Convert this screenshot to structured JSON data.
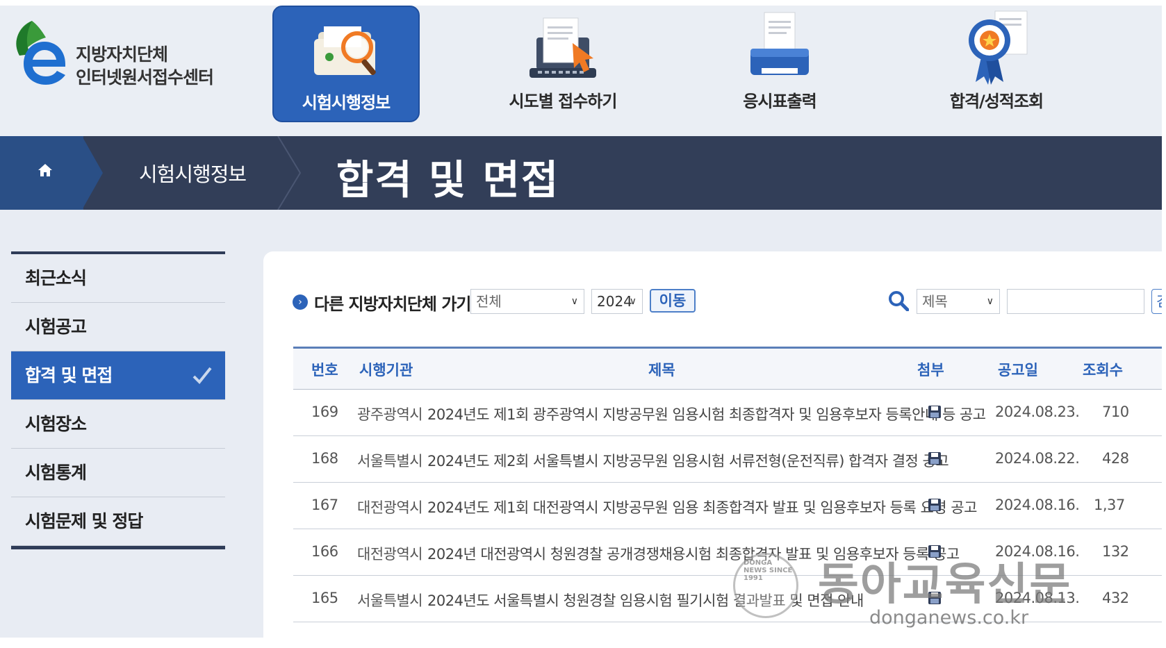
{
  "logo": {
    "line1": "지방자치단체",
    "line2": "인터넷원서접수센터"
  },
  "nav": [
    {
      "label": "시험시행정보",
      "icon": "folder-magnifier-icon",
      "active": true
    },
    {
      "label": "시도별 접수하기",
      "icon": "laptop-document-icon",
      "active": false
    },
    {
      "label": "응시표출력",
      "icon": "printer-icon",
      "active": false
    },
    {
      "label": "합격/성적조회",
      "icon": "award-ribbon-icon",
      "active": false
    }
  ],
  "breadcrumb": {
    "home_icon": "home-icon",
    "current": "시험시행정보",
    "page_title": "합격 및 면접"
  },
  "sidebar": {
    "items": [
      {
        "label": "최근소식",
        "active": false
      },
      {
        "label": "시험공고",
        "active": false
      },
      {
        "label": "합격 및 면접",
        "active": true
      },
      {
        "label": "시험장소",
        "active": false
      },
      {
        "label": "시험통계",
        "active": false
      },
      {
        "label": "시험문제 및 정답",
        "active": false
      }
    ]
  },
  "filters": {
    "goto_label": "다른 지방자치단체 가기",
    "region_value": "전체",
    "year_value": "2024",
    "move_label": "이동",
    "search_field_value": "제목",
    "search_value": "",
    "search_button_label": "검"
  },
  "table": {
    "headers": {
      "num": "번호",
      "org": "시행기관",
      "title": "제목",
      "attach": "첨부",
      "date": "공고일",
      "views": "조회수"
    },
    "rows": [
      {
        "num": "169",
        "org": "광주광역시",
        "title": "2024년도 제1회 광주광역시 지방공무원 임용시험 최종합격자 및 임용후보자 등록안내 등 공고",
        "date": "2024.08.23.",
        "views": "710"
      },
      {
        "num": "168",
        "org": "서울특별시",
        "title": "2024년도 제2회 서울특별시 지방공무원 임용시험 서류전형(운전직류) 합격자 결정 공고",
        "date": "2024.08.22.",
        "views": "428"
      },
      {
        "num": "167",
        "org": "대전광역시",
        "title": "2024년도 제1회 대전광역시 지방공무원 임용 최종합격자 발표 및 임용후보자 등록 요령 공고",
        "date": "2024.08.16.",
        "views": "1,37"
      },
      {
        "num": "166",
        "org": "대전광역시",
        "title": "2024년 대전광역시 청원경찰 공개경쟁채용시험 최종합격자 발표 및 임용후보자 등록 공고",
        "date": "2024.08.16.",
        "views": "132"
      },
      {
        "num": "165",
        "org": "서울특별시",
        "title": "2024년도 서울특별시 청원경찰 임용시험 필기시험 결과발표 및 면접 안내",
        "date": "2024.08.13.",
        "views": "432"
      }
    ],
    "attach_icon": "floppy-disk-icon"
  },
  "watermark": {
    "seal_text": "DONGA NEWS SINCE 1991",
    "name": "동아교육신문",
    "url": "donganews.co.kr"
  }
}
